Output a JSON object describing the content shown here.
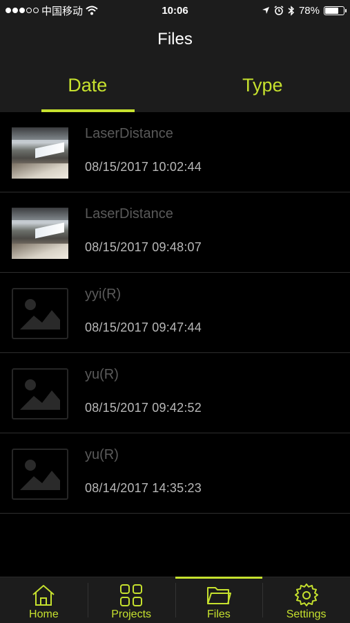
{
  "status_bar": {
    "carrier": "中国移动",
    "time": "10:06",
    "battery": "78%",
    "battery_level": 0.78,
    "signal_filled": 3,
    "signal_total": 5
  },
  "nav": {
    "title": "Files"
  },
  "tabs": [
    {
      "label": "Date",
      "active": true
    },
    {
      "label": "Type",
      "active": false
    }
  ],
  "files": [
    {
      "name": "LaserDistance",
      "date": "08/15/2017 10:02:44",
      "thumbnail": "photo"
    },
    {
      "name": "LaserDistance",
      "date": "08/15/2017 09:48:07",
      "thumbnail": "photo"
    },
    {
      "name": "yyi(R)",
      "date": "08/15/2017 09:47:44",
      "thumbnail": "image-placeholder-icon"
    },
    {
      "name": "yu(R)",
      "date": "08/15/2017 09:42:52",
      "thumbnail": "image-placeholder-icon"
    },
    {
      "name": "yu(R)",
      "date": "08/14/2017 14:35:23",
      "thumbnail": "image-placeholder-icon"
    }
  ],
  "tab_bar": [
    {
      "label": "Home",
      "icon": "home-icon",
      "active": false
    },
    {
      "label": "Projects",
      "icon": "grid-icon",
      "active": false
    },
    {
      "label": "Files",
      "icon": "folder-icon",
      "active": true
    },
    {
      "label": "Settings",
      "icon": "gear-icon",
      "active": false
    }
  ],
  "colors": {
    "accent": "#c6e12e",
    "background": "#000000",
    "bar": "#1c1c1c"
  }
}
